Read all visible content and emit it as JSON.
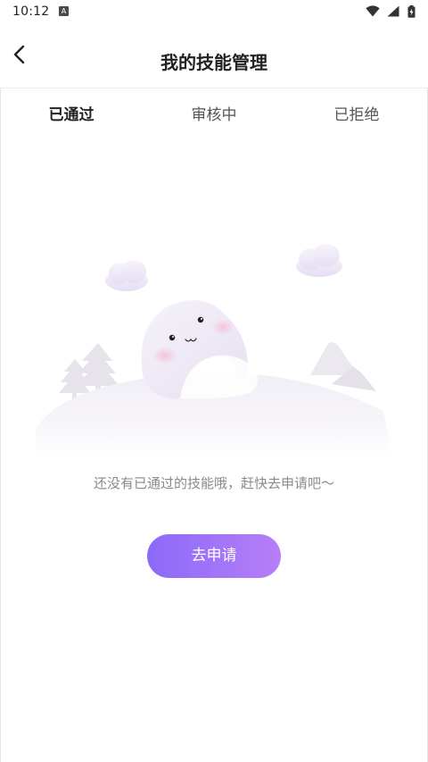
{
  "status_bar": {
    "time": "10:12",
    "notification_glyph": "A",
    "icons": [
      "wifi-icon",
      "signal-icon",
      "battery-icon"
    ]
  },
  "header": {
    "title": "我的技能管理",
    "back_icon": "chevron-left-icon"
  },
  "tabs": [
    {
      "label": "已通过",
      "active": true
    },
    {
      "label": "审核中",
      "active": false
    },
    {
      "label": "已拒绝",
      "active": false
    }
  ],
  "empty_state": {
    "illustration": "ghost-on-hill-illustration",
    "message": "还没有已通过的技能哦，赶快去申请吧～",
    "button_label": "去申请"
  },
  "colors": {
    "accent_start": "#8b6af8",
    "accent_end": "#b77ef7",
    "message_text": "#8a8a8a"
  }
}
